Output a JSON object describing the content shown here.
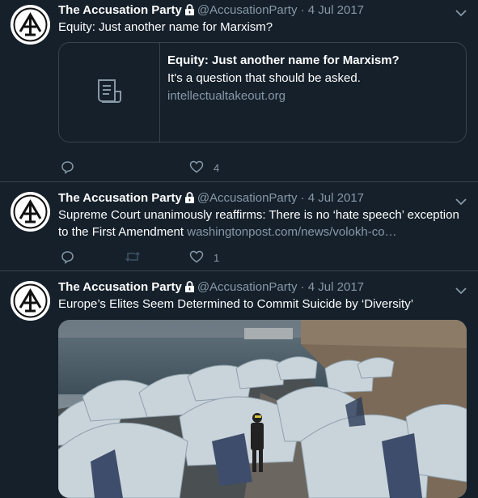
{
  "tweets": [
    {
      "name": "The Accusation Party",
      "handle": "@AccusationParty",
      "sep": "·",
      "date": "4 Jul 2017",
      "text": "Equity: Just another name for Marxism?",
      "card": {
        "title": "Equity: Just another name for Marxism?",
        "description": "It's a question that should be asked.",
        "domain": "intellectualtakeout.org"
      },
      "likes": "4"
    },
    {
      "name": "The Accusation Party",
      "handle": "@AccusationParty",
      "sep": "·",
      "date": "4 Jul 2017",
      "text": "Supreme Court unanimously reaffirms: There is no ‘hate speech’ exception to the First Amendment",
      "link": "washingtonpost.com/news/volokh-co…",
      "likes": "1"
    },
    {
      "name": "The Accusation Party",
      "handle": "@AccusationParty",
      "sep": "·",
      "date": "4 Jul 2017",
      "text": "Europe’s Elites Seem Determined to Commit Suicide by ‘Diversity’"
    }
  ],
  "icons": {
    "lock": "lock-icon",
    "chevron": "chevron-down-icon",
    "reply": "reply-icon",
    "retweet": "retweet-icon",
    "like": "heart-icon",
    "article": "article-icon"
  },
  "colors": {
    "bg": "#15202b",
    "border": "#38444d",
    "muted": "#8899a6"
  }
}
